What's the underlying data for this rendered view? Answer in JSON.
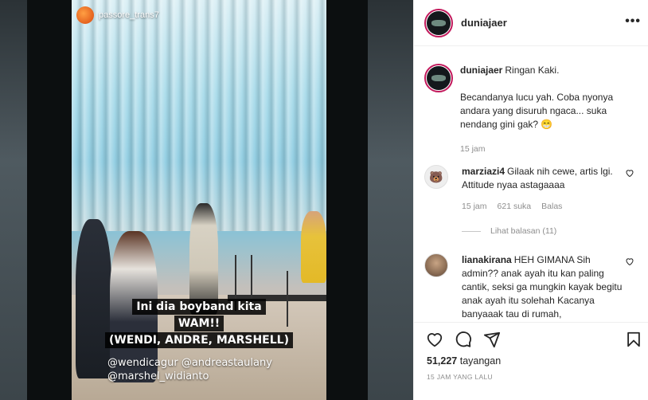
{
  "post": {
    "username": "duniajaer"
  },
  "media": {
    "overlay_username": "passore_trans7",
    "caption_lines": [
      "Ini dia boyband kita",
      "WAM!!",
      "(WENDI, ANDRE, MARSHELL)"
    ],
    "tags": [
      "@wendicagur @andreastaulany",
      "@marshel_widianto"
    ]
  },
  "comments": [
    {
      "username": "duniajaer",
      "text": "Ringan Kaki.",
      "text2": "Becandanya lucu yah. Coba nyonya andara yang disuruh ngaca... suka nendang gini gak? 😁",
      "time": "15 jam"
    },
    {
      "username": "marziazi4",
      "text": "Gilaak nih cewe, artis lgi. Attitude nyaa astagaaaa",
      "time": "15 jam",
      "likes": "621 suka",
      "reply": "Balas"
    },
    {
      "username": "lianakirana",
      "text": "HEH GIMANA Sih admin?? anak ayah itu kan paling cantik, seksi ga mungkin kayak begitu anak ayah itu solehah Kacanya banyaaak tau di rumah,"
    }
  ],
  "view_replies": "Lihat balasan (11)",
  "stats": {
    "views_count": "51,227",
    "views_label": "tayangan",
    "timestamp": "15 JAM YANG LALU"
  },
  "icons": [
    "more-icon",
    "heart-icon",
    "comment-icon",
    "share-icon",
    "bookmark-icon"
  ]
}
